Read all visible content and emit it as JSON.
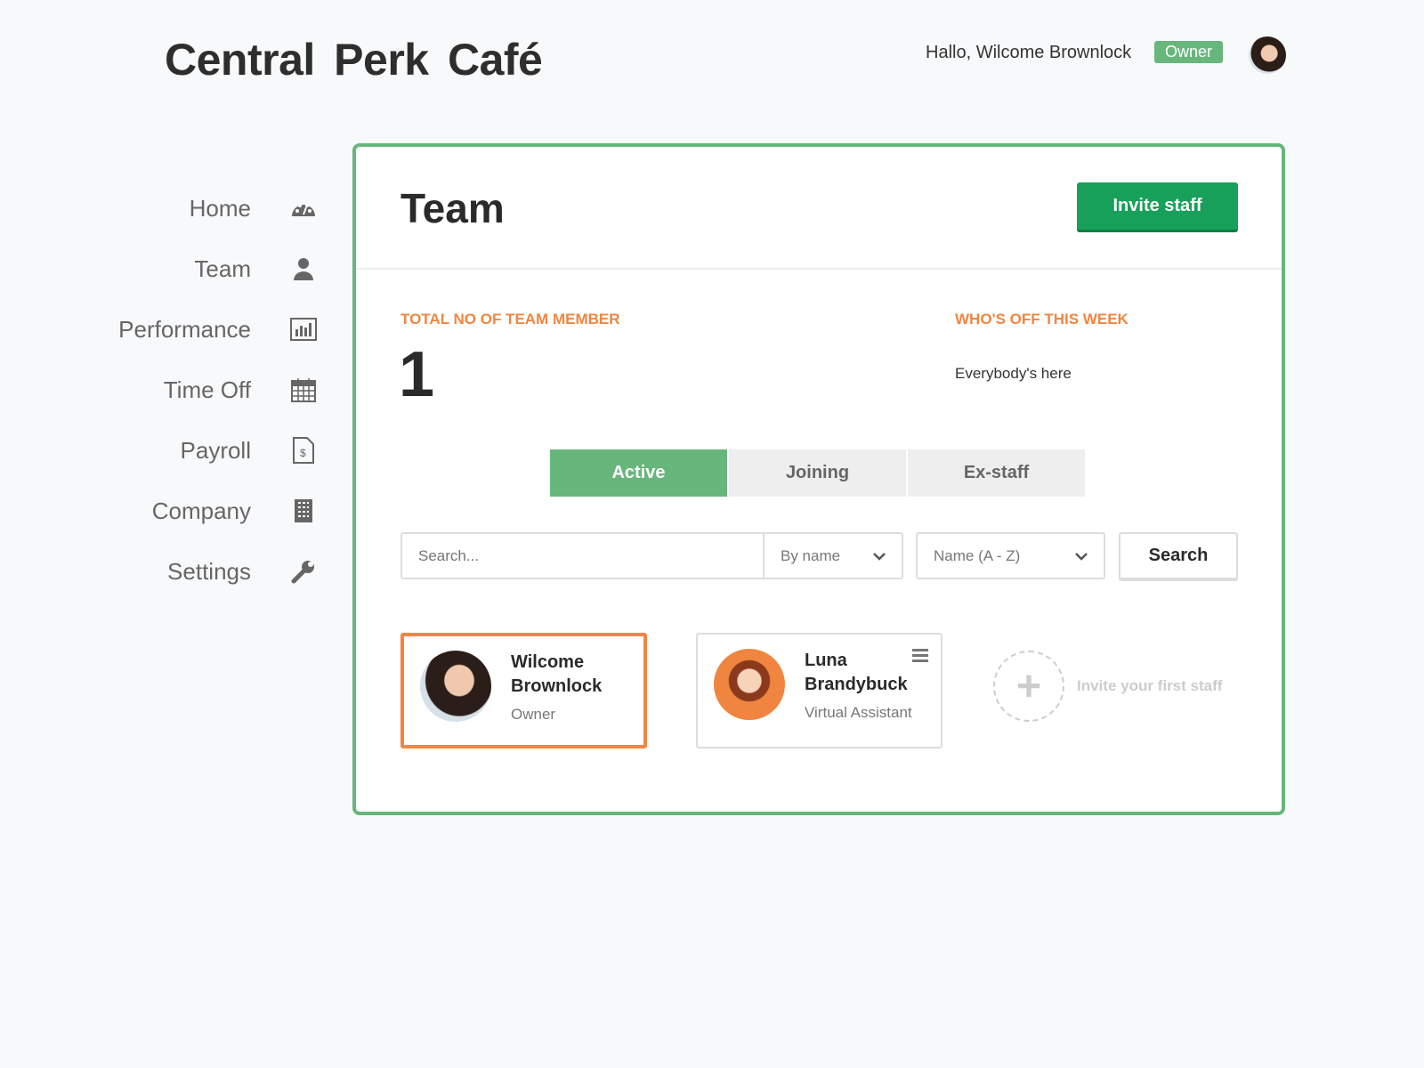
{
  "app": {
    "title": "Central Perk Café",
    "greeting": "Hallo, Wilcome Brownlock",
    "role_badge": "Owner"
  },
  "nav": [
    {
      "label": "Home",
      "icon": "dashboard-icon"
    },
    {
      "label": "Team",
      "icon": "user-icon"
    },
    {
      "label": "Performance",
      "icon": "bar-chart-icon"
    },
    {
      "label": "Time Off",
      "icon": "calendar-icon"
    },
    {
      "label": "Payroll",
      "icon": "invoice-icon"
    },
    {
      "label": "Company",
      "icon": "building-icon"
    },
    {
      "label": "Settings",
      "icon": "wrench-icon"
    }
  ],
  "page": {
    "title": "Team",
    "invite_label": "Invite staff",
    "total_label": "TOTAL NO OF TEAM MEMBER",
    "total_value": "1",
    "off_label": "WHO'S OFF THIS WEEK",
    "off_value": "Everybody's here",
    "tabs": [
      "Active",
      "Joining",
      "Ex-staff"
    ],
    "active_tab": "Active",
    "search": {
      "placeholder": "Search...",
      "value": "",
      "filter": "By name",
      "sort": "Name (A - Z)",
      "button": "Search"
    },
    "members": [
      {
        "name_first": "Wilcome",
        "name_last": "Brownlock",
        "role": "Owner"
      },
      {
        "name_first": "Luna",
        "name_last": "Brandybuck",
        "role": "Virtual Assistant"
      }
    ],
    "invite_first": "Invite your first staff"
  },
  "colors": {
    "accent_green": "#67b67b",
    "button_green": "#17a05a",
    "orange": "#f2853f"
  }
}
